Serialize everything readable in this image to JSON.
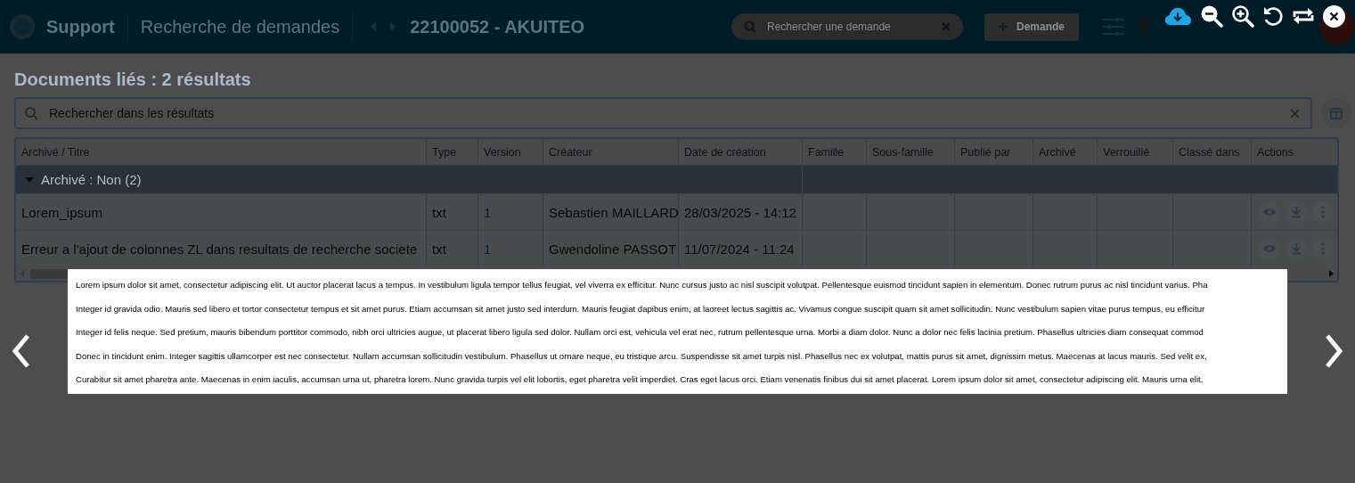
{
  "header": {
    "app": "Support",
    "breadcrumb": "Recherche de demandes",
    "record": "22100052 - AKUITEO",
    "search": {
      "placeholder": "Rechercher une demande"
    },
    "new_button": "Demande"
  },
  "documents": {
    "title": "Documents liés : 2 résultats",
    "search": {
      "placeholder": "Rechercher dans les résultats"
    },
    "table": {
      "columns": [
        "Archivé / Titre",
        "Type",
        "Version",
        "Créateur",
        "Date de création",
        "Famille",
        "Sous-famille",
        "Publié par",
        "Archivé",
        "Verrouillé",
        "Classé dans",
        "Actions"
      ],
      "group": {
        "label": "Archivé : Non (2)",
        "expanded": true
      },
      "rows": [
        {
          "title": "Lorem_ipsum",
          "type": "txt",
          "version": "1",
          "creator": "Sebastien MAILLARD",
          "created": "28/03/2025 - 14:12"
        },
        {
          "title": "Erreur a l'ajout de colonnes ZL dans resultats de recherche societe",
          "type": "txt",
          "version": "1",
          "creator": "Gwendoline PASSOT",
          "created": "11/07/2024 - 11:24"
        }
      ]
    }
  },
  "viewer": {
    "preview_lines": [
      "Lorem ipsum dolor sit amet, consectetur adipiscing elit. Ut auctor placerat lacus a tempus. In vestibulum ligula tempor tellus feugiat, vel viverra ex efficitur. Nunc cursus justo ac nisl suscipit volutpat. Pellentesque euismod tincidunt sapien in elementum. Donec rutrum purus ac nisl tincidunt varius. Pha",
      "Integer id gravida odio. Mauris sed libero et tortor consectetur tempus et sit amet purus. Etiam accumsan sit amet justo sed interdum. Mauris feugiat dapibus enim, at laoreet lectus sagittis ac. Vivamus congue suscipit quam sit amet sollicitudin. Nunc vestibulum sapien vitae purus tempus, eu efficitur",
      "Integer id felis neque. Sed pretium, mauris bibendum porttitor commodo, nibh orci ultricies augue, ut placerat libero ligula sed dolor. Nullam orci est, vehicula vel erat nec, rutrum pellentesque urna. Morbi a diam dolor. Nunc a dolor nec felis lacinia pretium. Phasellus ultricies diam consequat commod",
      "Donec in tincidunt enim. Integer sagittis ullamcorper est nec consectetur. Nullam accumsan sollicitudin vestibulum. Phasellus ut ornare neque, eu tristique arcu. Suspendisse sit amet turpis nisl. Phasellus nec ex volutpat, mattis purus sit amet, dignissim metus. Maecenas at lacus mauris. Sed velit ex,",
      "Curabitur sit amet pharetra ante. Maecenas in enim iaculis, accumsan urna ut, pharetra lorem. Nunc gravida turpis vel elit lobortis, eget pharetra velit imperdiet. Cras eget lacus orci. Etiam venenatis finibus dui sit amet placerat. Lorem ipsum dolor sit amet, consectetur adipiscing elit. Mauris urna elit,"
    ]
  }
}
